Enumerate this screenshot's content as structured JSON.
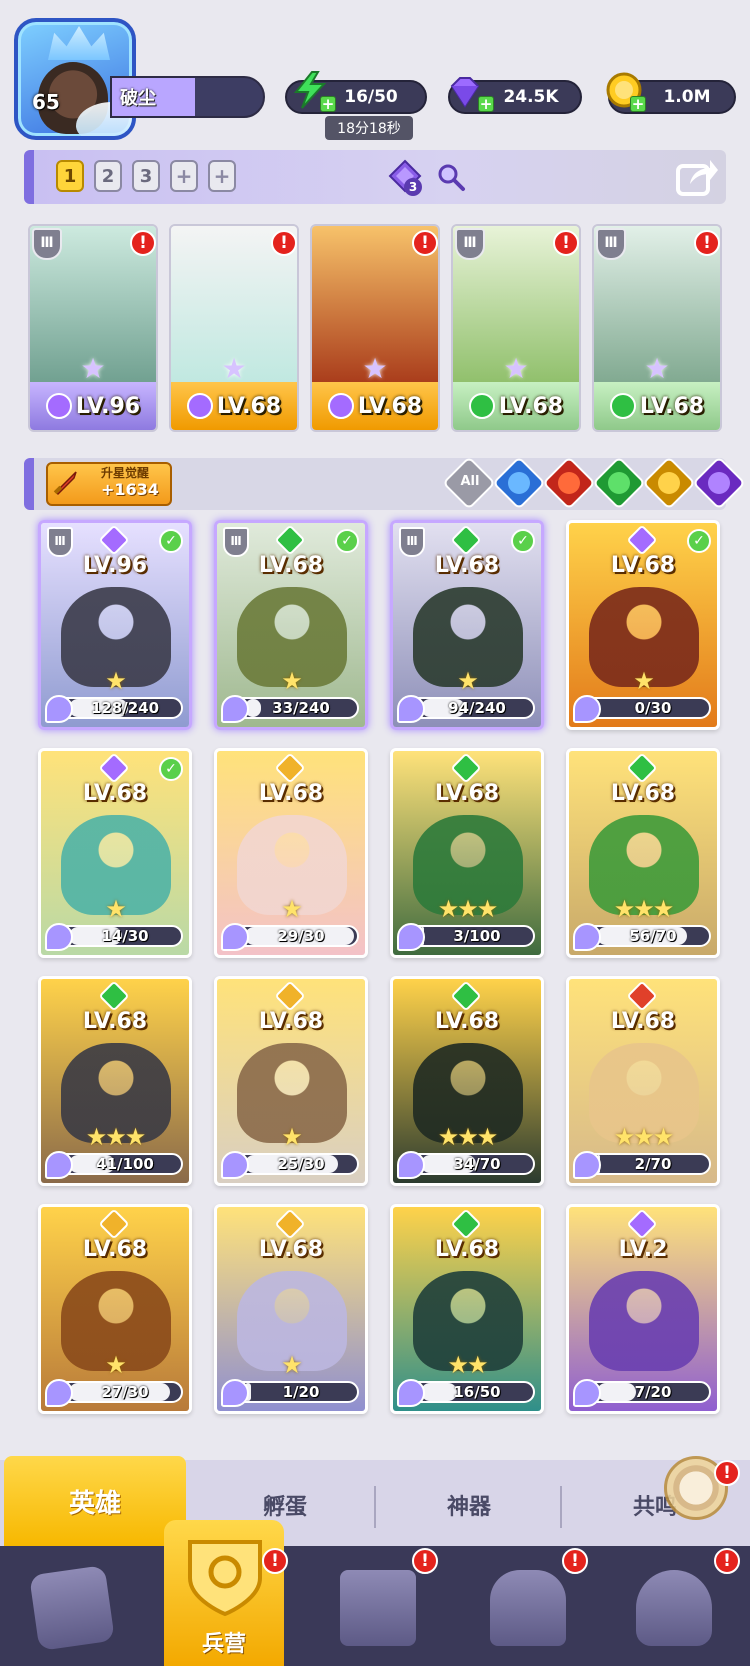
{
  "player": {
    "level": "65",
    "name": "破尘"
  },
  "resources": {
    "energy": "16/50",
    "energy_timer": "18分18秒",
    "gems": "24.5K",
    "gold": "1.0M"
  },
  "team_tabs": [
    "1",
    "2",
    "3",
    "+",
    "+"
  ],
  "gem_badge": "3",
  "team_cards": [
    {
      "level": "LV.96",
      "element": "dark",
      "color": "#a46bff"
    },
    {
      "level": "LV.68",
      "element": "dark",
      "color": "#a46bff"
    },
    {
      "level": "LV.68",
      "element": "dark",
      "color": "#a46bff"
    },
    {
      "level": "LV.68",
      "element": "nature",
      "color": "#2fbf43"
    },
    {
      "level": "LV.68",
      "element": "nature",
      "color": "#2fbf43"
    }
  ],
  "awaken": {
    "label": "升星觉醒",
    "value": "+1634"
  },
  "filter_all": "All",
  "alert_mark": "!",
  "rank_mark": "Ⅲ",
  "heroes": [
    {
      "level": "LV.96",
      "progress": "128/240",
      "frac": 0.53,
      "element": "#a46bff",
      "stars": "★",
      "check": true,
      "shield": true,
      "selected": true,
      "bg": "linear-gradient(#e6e0ff,#8f9bd0)",
      "char": "#3b3b4a"
    },
    {
      "level": "LV.68",
      "progress": "33/240",
      "frac": 0.14,
      "element": "#2fbf43",
      "stars": "★",
      "check": true,
      "shield": true,
      "selected": true,
      "bg": "linear-gradient(#e0eadb,#9fb88f)",
      "char": "#6b7b3a"
    },
    {
      "level": "LV.68",
      "progress": "94/240",
      "frac": 0.39,
      "element": "#2fbf43",
      "stars": "★",
      "check": true,
      "shield": true,
      "selected": true,
      "bg": "linear-gradient(#e2e0f0,#8d8fb8)",
      "char": "#2b3b2f"
    },
    {
      "level": "LV.68",
      "progress": "0/30",
      "frac": 0.0,
      "element": "#a46bff",
      "stars": "★",
      "check": true,
      "shield": false,
      "selected": false,
      "bg": "linear-gradient(#ffd24a,#e27a1a)",
      "char": "#7a2a1a"
    },
    {
      "level": "LV.68",
      "progress": "14/30",
      "frac": 0.47,
      "element": "#a46bff",
      "stars": "★",
      "check": true,
      "shield": false,
      "selected": false,
      "bg": "linear-gradient(#ffe27a,#b9d9a6)",
      "char": "#4fb3a6"
    },
    {
      "level": "LV.68",
      "progress": "29/30",
      "frac": 0.97,
      "element": "#f0b22a",
      "stars": "★",
      "check": false,
      "shield": false,
      "selected": false,
      "bg": "linear-gradient(#ffe27a,#f3c2c8)",
      "char": "#f2d6d0"
    },
    {
      "level": "LV.68",
      "progress": "3/100",
      "frac": 0.03,
      "element": "#2fbf43",
      "stars": "★★★",
      "check": false,
      "shield": false,
      "selected": false,
      "bg": "linear-gradient(#ffe27a,#3f6b3f)",
      "char": "#2d7a3a"
    },
    {
      "level": "LV.68",
      "progress": "56/70",
      "frac": 0.8,
      "element": "#2fbf43",
      "stars": "★★★",
      "check": false,
      "shield": false,
      "selected": false,
      "bg": "linear-gradient(#ffe27a,#c8a96a)",
      "char": "#3f9b3a"
    },
    {
      "level": "LV.68",
      "progress": "41/100",
      "frac": 0.41,
      "element": "#2fbf43",
      "stars": "★★★",
      "check": false,
      "shield": false,
      "selected": false,
      "bg": "linear-gradient(#ffd24a,#8a6a4a)",
      "char": "#3a3a44"
    },
    {
      "level": "LV.68",
      "progress": "25/30",
      "frac": 0.83,
      "element": "#f0b22a",
      "stars": "★",
      "check": false,
      "shield": false,
      "selected": false,
      "bg": "linear-gradient(#ffe27a,#d9cfc2)",
      "char": "#8a6a4a"
    },
    {
      "level": "LV.68",
      "progress": "34/70",
      "frac": 0.49,
      "element": "#2fbf43",
      "stars": "★★★",
      "check": false,
      "shield": false,
      "selected": false,
      "bg": "linear-gradient(#ffd24a,#2b3b2f)",
      "char": "#1f2a22"
    },
    {
      "level": "LV.68",
      "progress": "2/70",
      "frac": 0.03,
      "element": "#e0402a",
      "stars": "★★★",
      "check": false,
      "shield": false,
      "selected": false,
      "bg": "linear-gradient(#ffe27a,#d6b98a)",
      "char": "#e8c58a"
    },
    {
      "level": "LV.68",
      "progress": "27/30",
      "frac": 0.9,
      "element": "#f0b22a",
      "stars": "★",
      "check": false,
      "shield": false,
      "selected": false,
      "bg": "linear-gradient(#ffd24a,#b87a3a)",
      "char": "#8a4a1a"
    },
    {
      "level": "LV.68",
      "progress": "1/20",
      "frac": 0.05,
      "element": "#f0b22a",
      "stars": "★",
      "check": false,
      "shield": false,
      "selected": false,
      "bg": "linear-gradient(#ffe27a,#8f8fd0)",
      "char": "#bcb7e0"
    },
    {
      "level": "LV.68",
      "progress": "16/50",
      "frac": 0.32,
      "element": "#2fbf43",
      "stars": "★★",
      "check": false,
      "shield": false,
      "selected": false,
      "bg": "linear-gradient(#ffd24a,#2f8f8a)",
      "char": "#1f3f3a"
    },
    {
      "level": "LV.2",
      "progress": "7/20",
      "frac": 0.35,
      "element": "#a46bff",
      "stars": "",
      "check": false,
      "shield": false,
      "selected": false,
      "bg": "linear-gradient(#ffe27a,#8f5fd0)",
      "char": "#6a3fb0"
    }
  ],
  "subtabs": {
    "active": "英雄",
    "t2": "孵蛋",
    "t3": "神器",
    "t4": "共鸣"
  },
  "nav": {
    "active_label": "兵营"
  }
}
